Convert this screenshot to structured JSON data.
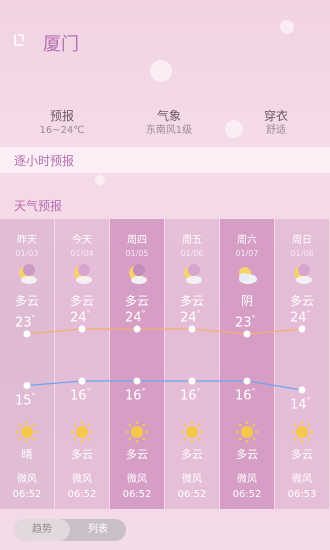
{
  "header": {
    "city": "厦门",
    "back_icon": "back-icon"
  },
  "summary": [
    {
      "title": "预报",
      "value": "16~24℃"
    },
    {
      "title": "气象",
      "value": "东南风1级"
    },
    {
      "title": "穿衣",
      "value": "舒适"
    }
  ],
  "hourly": {
    "title": "逐小时预报"
  },
  "forecast": {
    "title": "天气预报",
    "days": [
      {
        "day": "昨天",
        "date": "01/03",
        "icon": "moon-cloud-icon",
        "condition": "多云",
        "high": 23,
        "low": 15,
        "condition2": "晴",
        "wind": "微风",
        "time": "06:52"
      },
      {
        "day": "今天",
        "date": "01/04",
        "icon": "moon-cloud-icon",
        "condition": "多云",
        "high": 24,
        "low": 16,
        "condition2": "多云",
        "wind": "微风",
        "time": "06:52"
      },
      {
        "day": "周四",
        "date": "01/05",
        "icon": "moon-cloud-icon",
        "condition": "多云",
        "high": 24,
        "low": 16,
        "condition2": "多云",
        "wind": "微风",
        "time": "06:52"
      },
      {
        "day": "周五",
        "date": "01/06",
        "icon": "moon-cloud-icon",
        "condition": "多云",
        "high": 24,
        "low": 16,
        "condition2": "多云",
        "wind": "微风",
        "time": "06:52"
      },
      {
        "day": "周六",
        "date": "01/07",
        "icon": "overcast-icon",
        "condition": "阴",
        "high": 23,
        "low": 16,
        "condition2": "多云",
        "wind": "微风",
        "time": "06:52"
      },
      {
        "day": "周日",
        "date": "01/08",
        "icon": "moon-cloud-icon",
        "condition": "多云",
        "high": 24,
        "low": 14,
        "condition2": "多云",
        "wind": "微风",
        "time": "06:53"
      }
    ],
    "colors": {
      "high_line": "#f5b06a",
      "low_line": "#6aa6f0"
    }
  },
  "view_toggle": {
    "options": [
      "趋势",
      "列表"
    ],
    "selected": "趋势"
  },
  "colors": {
    "accent": "#b56fb0"
  }
}
